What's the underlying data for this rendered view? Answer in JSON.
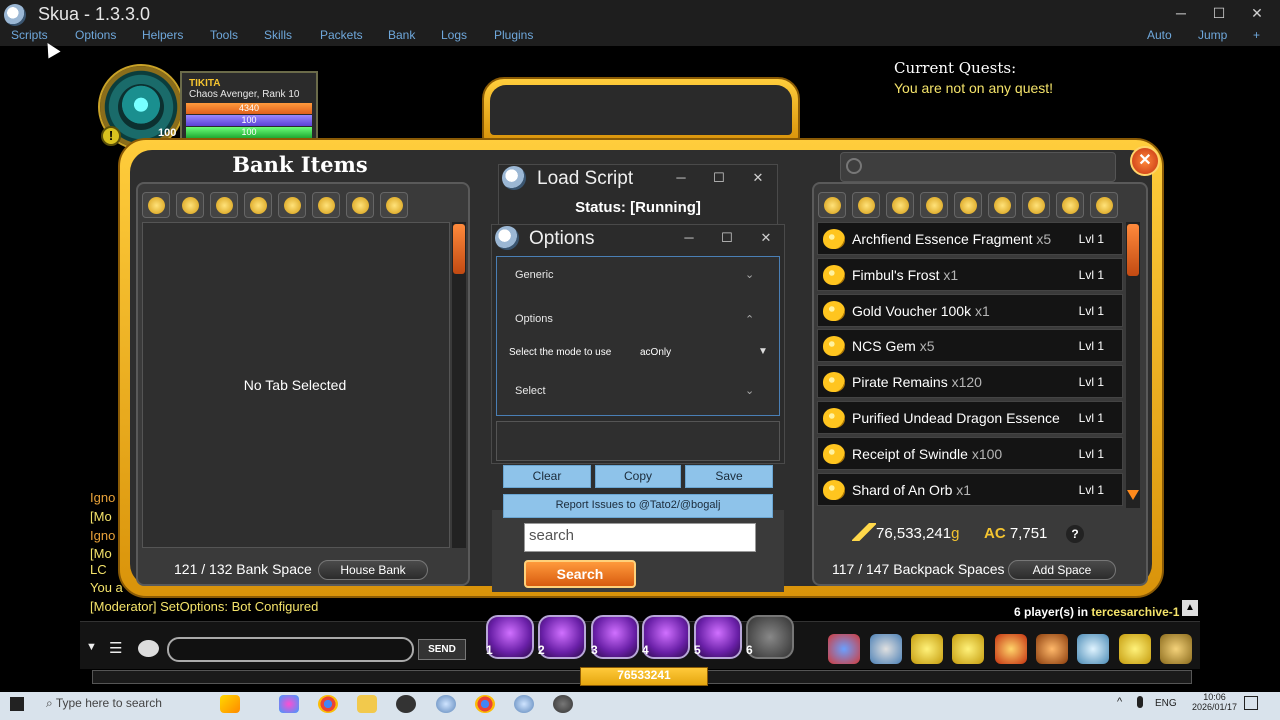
{
  "app": {
    "title": "Skua - 1.3.3.0"
  },
  "window_controls": {
    "minimize": "─",
    "maximize": "☐",
    "close": "✕"
  },
  "menu": {
    "items": [
      "Scripts",
      "Options",
      "Helpers",
      "Tools",
      "Skills",
      "Packets",
      "Bank",
      "Logs",
      "Plugins"
    ],
    "right": [
      "Auto",
      "Jump",
      "+"
    ]
  },
  "player": {
    "name": "TIKITA",
    "class_rank": "Chaos Avenger, Rank 10",
    "hp": "4340",
    "mp": "100",
    "sp": "100",
    "level": "100"
  },
  "quests": {
    "title": "Current Quests:",
    "text": "You are not on any quest!"
  },
  "bank": {
    "title": "Bank Items",
    "empty_text": "No Tab Selected",
    "space": "121 / 132 Bank Space",
    "house_bank": "House Bank"
  },
  "backpack": {
    "items": [
      {
        "name": "Archfiend Essence Fragment",
        "qty": "x5",
        "level": "Lvl 1"
      },
      {
        "name": "Fimbul's Frost",
        "qty": "x1",
        "level": "Lvl 1"
      },
      {
        "name": "Gold Voucher 100k",
        "qty": "x1",
        "level": "Lvl 1"
      },
      {
        "name": "NCS Gem",
        "qty": "x5",
        "level": "Lvl 1"
      },
      {
        "name": "Pirate Remains",
        "qty": "x120",
        "level": "Lvl 1"
      },
      {
        "name": "Purified Undead Dragon Essence",
        "qty": "",
        "level": "Lvl 1"
      },
      {
        "name": "Receipt of Swindle",
        "qty": "x100",
        "level": "Lvl 1"
      },
      {
        "name": "Shard of An Orb",
        "qty": "x1",
        "level": "Lvl 1"
      }
    ],
    "gold": "76,533,241",
    "gold_unit": "g",
    "ac": "7,751",
    "ac_symbol": "AC",
    "help": "?",
    "space": "117 / 147 Backpack Spaces",
    "add_space": "Add Space"
  },
  "search": {
    "placeholder": "search",
    "button": "Search"
  },
  "load_script": {
    "title": "Load Script",
    "status": "Status: [Running]"
  },
  "options_window": {
    "title": "Options",
    "sections": {
      "generic": "Generic",
      "options": "Options",
      "select": "Select"
    },
    "mode_label": "Select the mode to use",
    "mode_value": "acOnly",
    "buttons": {
      "clear": "Clear",
      "copy": "Copy",
      "save": "Save"
    },
    "report": "Report Issues to @Tato2/@bogalj"
  },
  "chat_log": [
    {
      "text": "Igno",
      "color": "#e8a23a"
    },
    {
      "text": "[Mo",
      "color": "#f4e36a"
    },
    {
      "text": "Igno",
      "color": "#e8a23a"
    },
    {
      "text": "[Mo",
      "color": "#f4e36a"
    },
    {
      "text": "  LC",
      "color": "#f4e36a"
    },
    {
      "text": "You a",
      "color": "#f4e36a"
    },
    {
      "text": "[Moderator] SetOptions: Bot Configured",
      "color": "#f4e36a"
    }
  ],
  "players": {
    "count_text": "6 player(s) in ",
    "server": "tercesarchive-1",
    "up": "▲"
  },
  "chat": {
    "send": "SEND"
  },
  "skills": [
    "1",
    "2",
    "3",
    "4",
    "5",
    "6"
  ],
  "xp": {
    "value": "76533241"
  },
  "taskbar": {
    "search": "Type here to search",
    "lang": "ENG",
    "time": "10:06",
    "date": "2026/01/17",
    "caret": "^"
  }
}
